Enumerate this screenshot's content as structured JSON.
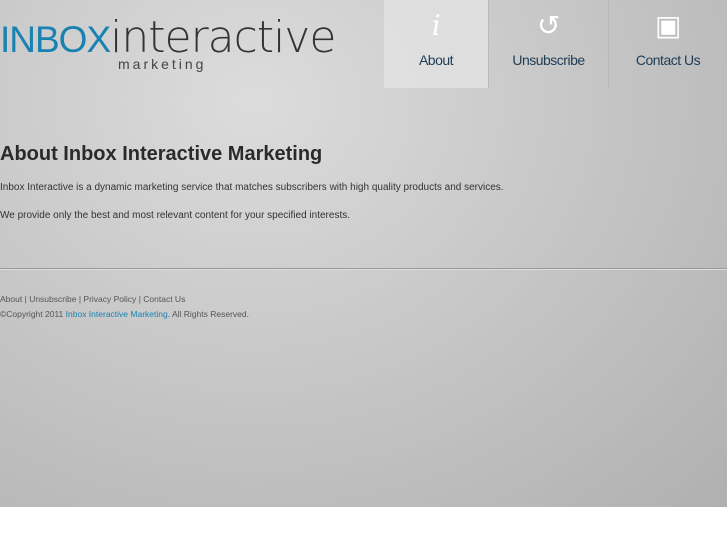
{
  "logo": {
    "inbox": "INBOX",
    "interactive": "interactive",
    "marketing": "marketing"
  },
  "nav": [
    {
      "label": "About",
      "icon": "info-icon",
      "glyph": "i"
    },
    {
      "label": "Unsubscribe",
      "icon": "undo-icon",
      "glyph": "↺"
    },
    {
      "label": "Contact Us",
      "icon": "contact-card-icon",
      "glyph": "▣"
    }
  ],
  "main": {
    "title": "About Inbox Interactive Marketing",
    "p1": "Inbox Interactive is a dynamic marketing service that matches subscribers with high quality products and services.",
    "p2": "We provide only the best and most relevant content for your specified interests."
  },
  "footer": {
    "links": [
      "About",
      "Unsubscribe",
      "Privacy Policy",
      "Contact Us"
    ],
    "sep": "|",
    "copy_pre": "©Copyright 2011",
    "copy_link": "Inbox Interactive Marketing",
    "copy_post": ". All Rights Reserved."
  }
}
